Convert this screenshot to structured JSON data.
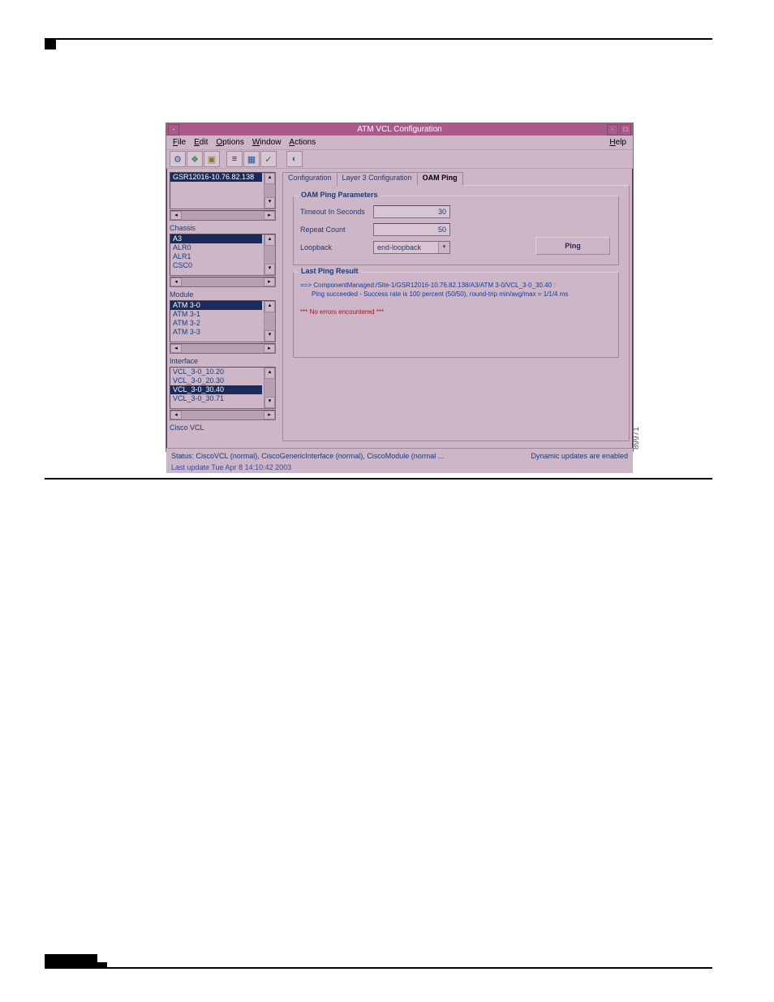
{
  "window_title": "ATM VCL Configuration",
  "image_number": "89971",
  "menu": {
    "file": "File",
    "edit": "Edit",
    "options": "Options",
    "window": "Window",
    "actions": "Actions",
    "help": "Help"
  },
  "left": {
    "device_label": "",
    "devices": [
      "GSR12016-10.76.82.138"
    ],
    "chassis_label": "Chassis",
    "chassis": [
      "A3",
      "ALR0",
      "ALR1",
      "CSC0"
    ],
    "chassis_selected": 0,
    "module_label": "Module",
    "modules": [
      "ATM 3-0",
      "ATM 3-1",
      "ATM 3-2",
      "ATM 3-3"
    ],
    "modules_selected": 0,
    "interface_label": "Interface",
    "interfaces": [
      "VCL_3-0_10.20",
      "VCL_3-0_20.30",
      "VCL_3-0_30.40",
      "VCL_3-0_30.71"
    ],
    "interfaces_selected": 2,
    "cisco_vcl_label": "Cisco VCL"
  },
  "tabs": {
    "configuration": "Configuration",
    "layer3": "Layer 3 Configuration",
    "oam": "OAM Ping"
  },
  "oam": {
    "group_title": "OAM Ping Parameters",
    "timeout_label": "Timeout In Seconds",
    "timeout_value": "30",
    "repeat_label": "Repeat Count",
    "repeat_value": "50",
    "loopback_label": "Loopback",
    "loopback_value": "end-loopback",
    "ping_button": "Ping",
    "result_title": "Last Ping Result",
    "result_line1": "==>  ComponentManaged:/Site-1/GSR12016-10.76.82.138/A3/ATM 3-0/VCL_3-0_30.40 :",
    "result_line2": "Ping succeeded - Success rate is 100 percent (50/50), round-trip min/avg/max = 1/1/4 ms",
    "result_noerr": "*** No errors encountered ***"
  },
  "status": {
    "left": "Status: CiscoVCL (normal), CiscoGenericInterface (normal), CiscoModule (normal ...",
    "right": "Dynamic updates are enabled",
    "update": "Last update Tue Apr  8 14:10:42 2003"
  }
}
